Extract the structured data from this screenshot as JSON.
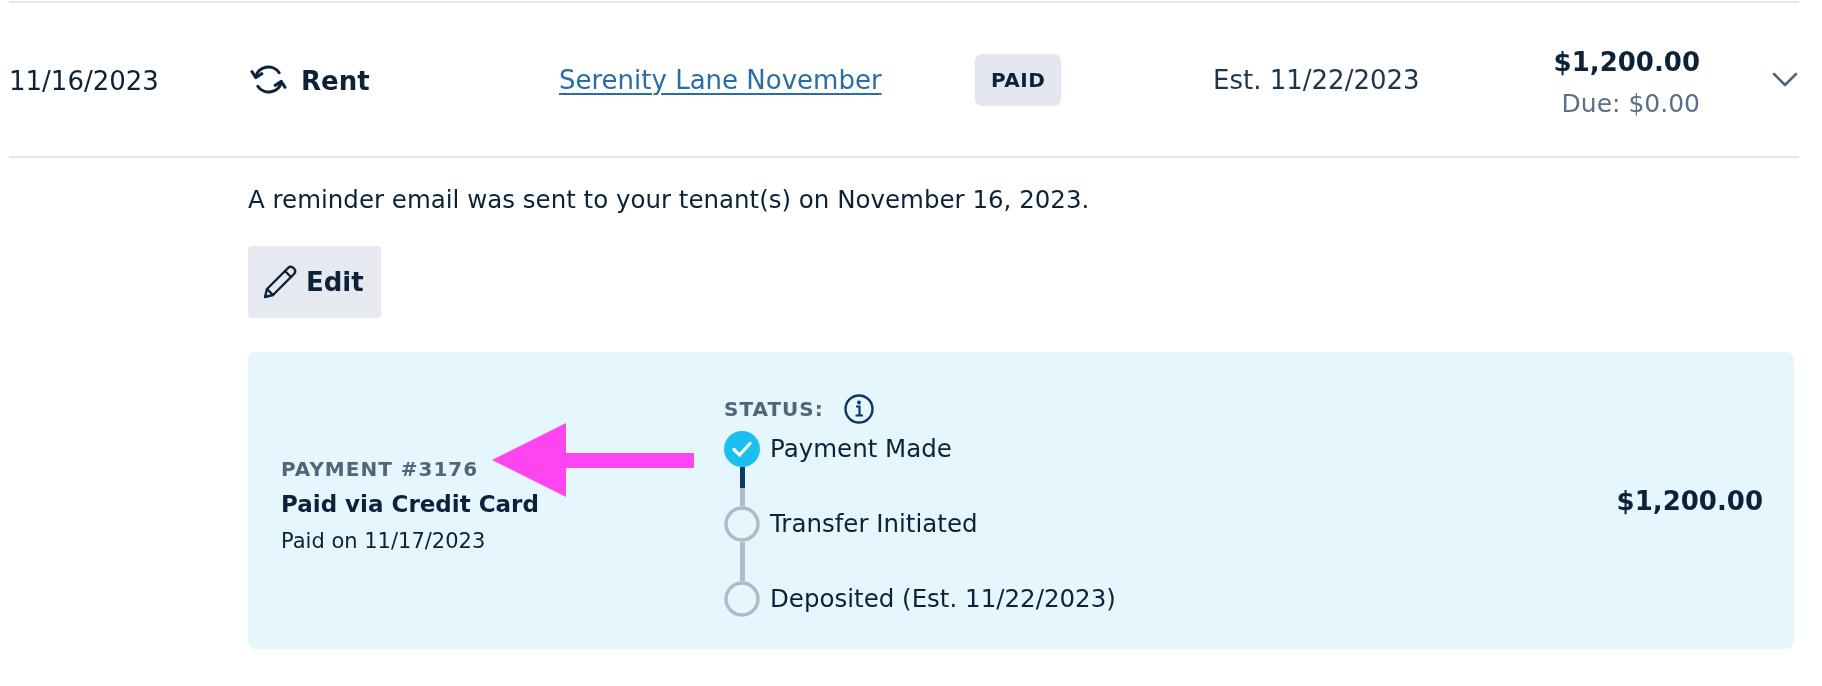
{
  "transaction": {
    "date": "11/16/2023",
    "category": "Rent",
    "description_link": "Serenity Lane November",
    "status_badge": "PAID",
    "estimate": "Est. 11/22/2023",
    "amount": "$1,200.00",
    "due": "Due: $0.00",
    "expanded": true
  },
  "details": {
    "reminder": "A reminder email was sent to your tenant(s) on November 16, 2023.",
    "edit_button": "Edit",
    "payment": {
      "number": "PAYMENT #3176",
      "method": "Paid via Credit Card",
      "paid_on": "Paid on 11/17/2023",
      "status_label": "STATUS:",
      "steps": [
        {
          "label": "Payment Made",
          "done": true
        },
        {
          "label": "Transfer Initiated",
          "done": false
        },
        {
          "label": "Deposited (Est. 11/22/2023)",
          "done": false
        }
      ],
      "amount": "$1,200.00"
    }
  }
}
